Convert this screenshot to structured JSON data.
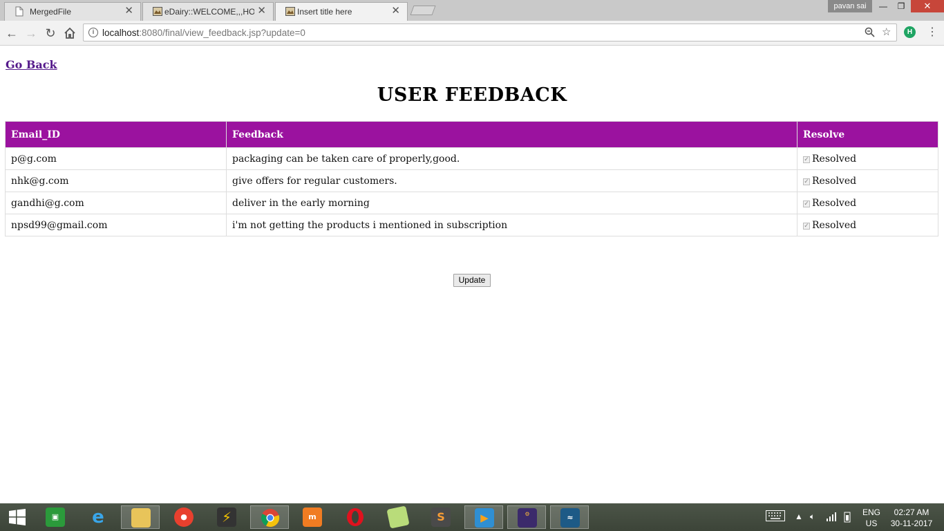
{
  "browser": {
    "tabs": [
      {
        "title": "MergedFile",
        "active": false
      },
      {
        "title": "eDairy::WELCOME,,,HOM",
        "active": false
      },
      {
        "title": "Insert title here",
        "active": true
      }
    ],
    "profile_name": "pavan sai",
    "url_host": "localhost",
    "url_path": ":8080/final/view_feedback.jsp?update=0"
  },
  "page": {
    "go_back": "Go Back",
    "title": "USER FEEDBACK",
    "table": {
      "headers": [
        "Email_ID",
        "Feedback",
        "Resolve"
      ],
      "rows": [
        {
          "email": "p@g.com",
          "feedback": "packaging can be taken care of properly,good.",
          "resolve": "Resolved",
          "checked": true
        },
        {
          "email": "nhk@g.com",
          "feedback": "give offers for regular customers.",
          "resolve": "Resolved",
          "checked": true
        },
        {
          "email": "gandhi@g.com",
          "feedback": "deliver in the early morning",
          "resolve": "Resolved",
          "checked": true
        },
        {
          "email": "npsd99@gmail.com",
          "feedback": "i'm not getting the products i mentioned in subscription",
          "resolve": "Resolved",
          "checked": true
        }
      ]
    },
    "update_label": "Update"
  },
  "taskbar": {
    "lang_top": "ENG",
    "lang_bottom": "US",
    "time": "02:27 AM",
    "date": "30-11-2017"
  },
  "colors": {
    "header_bg": "#9b129f",
    "link": "#551a8b"
  }
}
